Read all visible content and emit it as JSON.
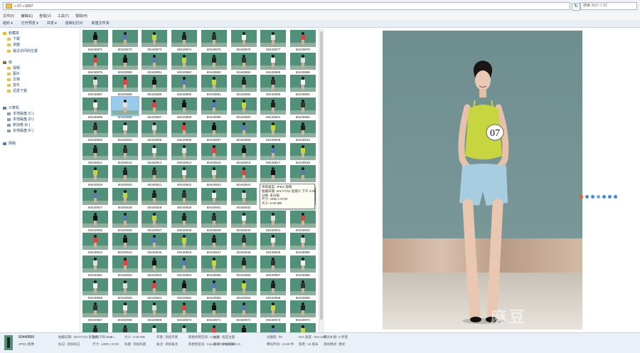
{
  "address_bar": {
    "path": "« 07 » 0007",
    "search_placeholder": "搜索 2017.7.22"
  },
  "menu": [
    "文件(F)",
    "编辑(E)",
    "查看(V)",
    "工具(T)",
    "帮助(H)"
  ],
  "toolbar": [
    "组织 ▾",
    "打开预览 ▾",
    "共享 ▾",
    "放映幻灯片",
    "新建文件夹"
  ],
  "nav_tree": [
    {
      "label": "收藏夹",
      "icon": "star-icon",
      "level": 0
    },
    {
      "label": "下载",
      "icon": "folder-icon",
      "level": 1
    },
    {
      "label": "桌面",
      "icon": "folder-icon",
      "level": 1
    },
    {
      "label": "最近访问的位置",
      "icon": "folder-icon",
      "level": 1
    },
    {
      "label": "库",
      "icon": "library-icon",
      "level": 0
    },
    {
      "label": "视频",
      "icon": "folder-icon",
      "level": 1
    },
    {
      "label": "图片",
      "icon": "folder-icon",
      "level": 1
    },
    {
      "label": "文档",
      "icon": "folder-icon",
      "level": 1
    },
    {
      "label": "音乐",
      "icon": "folder-icon",
      "level": 1
    },
    {
      "label": "迅雷下载",
      "icon": "folder-icon",
      "level": 1
    },
    {
      "label": "计算机",
      "icon": "computer-icon",
      "level": 0
    },
    {
      "label": "本地磁盘 (C:)",
      "icon": "drive-icon",
      "level": 1
    },
    {
      "label": "本地磁盘 (D:)",
      "icon": "drive-icon",
      "level": 1
    },
    {
      "label": "新加卷 (E:)",
      "icon": "drive-icon",
      "level": 1
    },
    {
      "label": "本地磁盘 (F:)",
      "icon": "drive-icon",
      "level": 1
    },
    {
      "label": "网络",
      "icon": "network-icon",
      "level": 0
    }
  ],
  "thumbnails": {
    "selected": "60440896",
    "rows": [
      [
        "60440871",
        "60440872",
        "60440873",
        "60440874",
        "60440875",
        "60440876",
        "60440877",
        "60440878"
      ],
      [
        "60440879",
        "60440880",
        "60440881",
        "60440882",
        "60440883",
        "60440884",
        "60440885",
        "60440886"
      ],
      [
        "60440887",
        "60440888",
        "60440889",
        "60440890",
        "60440891",
        "60440892",
        "60440893",
        "60440894"
      ],
      [
        "60440895",
        "60440896",
        "60440897",
        "60440898",
        "60440899",
        "60440900",
        "60440901",
        "60440902"
      ],
      [
        "60440903",
        "60440904",
        "60440905",
        "60440906",
        "60440907",
        "60440908",
        "60440909",
        "60440910"
      ],
      [
        "60440911",
        "60440912",
        "60440913",
        "60440914",
        "60440915",
        "60440916",
        "60440917",
        "60440918"
      ],
      [
        "60440919",
        "60440920",
        "60440921",
        "60440922",
        "60440923",
        "60440924",
        "60440925",
        "60440926"
      ],
      [
        "60440927",
        "60440928",
        "60440929",
        "60440930",
        "60440931",
        "60440932",
        "60440933",
        "60440934"
      ],
      [
        "60440935",
        "60440936",
        "60440937",
        "60440938",
        "60440939",
        "60440940",
        "60440941",
        "60440942"
      ],
      [
        "60440943",
        "60440944",
        "60440945",
        "60440946",
        "60440947",
        "60440948",
        "60440949",
        "60440950"
      ],
      [
        "60440951",
        "60440952",
        "60440953",
        "60440954",
        "60440955",
        "60440956",
        "60440957",
        "60440958"
      ],
      [
        "60440959",
        "60440960",
        "60440961",
        "60440962",
        "60440963",
        "60440964",
        "60440965",
        "60440966"
      ],
      [
        "60440967",
        "60440968",
        "60440969",
        "60440970",
        "60440971",
        "60440972",
        "60440973",
        "60440974"
      ],
      [
        "60440975",
        "60440976",
        "60440977",
        "60440978",
        "60440979",
        "60440980",
        "60440981",
        "60440982"
      ]
    ]
  },
  "tooltip": {
    "lines": [
      "项目类型: JPEG 图像",
      "拍摄日期: 2017/7/22 星期六 下午 4:06",
      "分级: 未分级",
      "尺寸: 4480 x 6720",
      "大小: 8.00 MB"
    ]
  },
  "preview": {
    "bib_number": "07",
    "watermark": "麻豆"
  },
  "details": {
    "name": "60440896",
    "type": "JPEG 图像",
    "fields": [
      {
        "label": "拍摄日期:",
        "value": "2017/7/22 星期六 下午 4:06"
      },
      {
        "label": "标记:",
        "value": "添加标记"
      },
      {
        "label": "分级:",
        "value": "☆☆☆☆☆"
      },
      {
        "label": "尺寸:",
        "value": "4480 x 6720"
      },
      {
        "label": "大小:",
        "value": "8.00 MB"
      },
      {
        "label": "标题:",
        "value": "添加标题"
      },
      {
        "label": "作者:",
        "value": "添加作者"
      },
      {
        "label": "备注:",
        "value": "添加备注"
      },
      {
        "label": "照相机制造商:",
        "value": "Canon"
      },
      {
        "label": "照相机型号:",
        "value": "Canon EOS 5D Mark III"
      },
      {
        "label": "主题:",
        "value": "指定主题"
      },
      {
        "label": "版权:",
        "value": "添加版权"
      },
      {
        "label": "光圈值:",
        "value": "f/8"
      },
      {
        "label": "曝光时间:",
        "value": "1/125 秒"
      },
      {
        "label": "ISO 速度:",
        "value": "ISO-100"
      },
      {
        "label": "焦距:",
        "value": "24 毫米"
      },
      {
        "label": "曝光补偿:",
        "value": "0 步骤"
      },
      {
        "label": "测光模式:",
        "value": "模式"
      }
    ]
  }
}
